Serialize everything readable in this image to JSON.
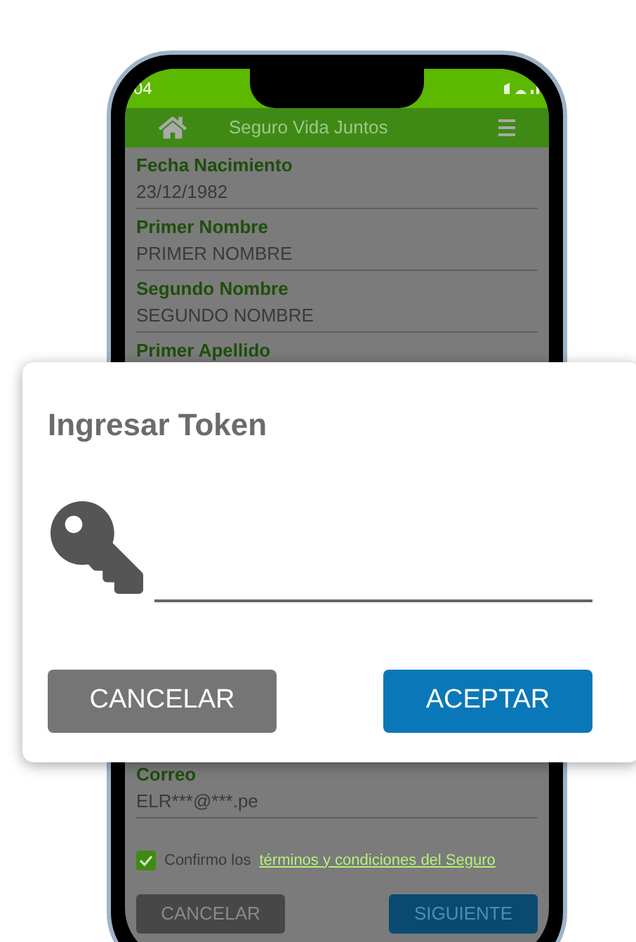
{
  "status_bar": {
    "time": "04"
  },
  "app_bar": {
    "title": "Seguro Vida Juntos"
  },
  "fields": [
    {
      "label": "Fecha Nacimiento",
      "value": "23/12/1982"
    },
    {
      "label": "Primer Nombre",
      "value": "PRIMER NOMBRE"
    },
    {
      "label": "Segundo Nombre",
      "value": "SEGUNDO NOMBRE"
    },
    {
      "label": "Primer Apellido"
    }
  ],
  "email_field": {
    "label": "Correo",
    "value": "ELR***@***.pe"
  },
  "terms": {
    "checked": true,
    "text": "Confirmo los",
    "link": "términos y condiciones del Seguro"
  },
  "buttons": [
    {
      "label": "CANCELAR",
      "kind": "secondary"
    },
    {
      "label": "SIGUIENTE",
      "kind": "primary"
    }
  ],
  "dialog": {
    "title": "Ingresar Token",
    "buttons": [
      {
        "label": "CANCELAR",
        "kind": "secondary"
      },
      {
        "label": "ACEPTAR",
        "kind": "primary"
      }
    ]
  }
}
